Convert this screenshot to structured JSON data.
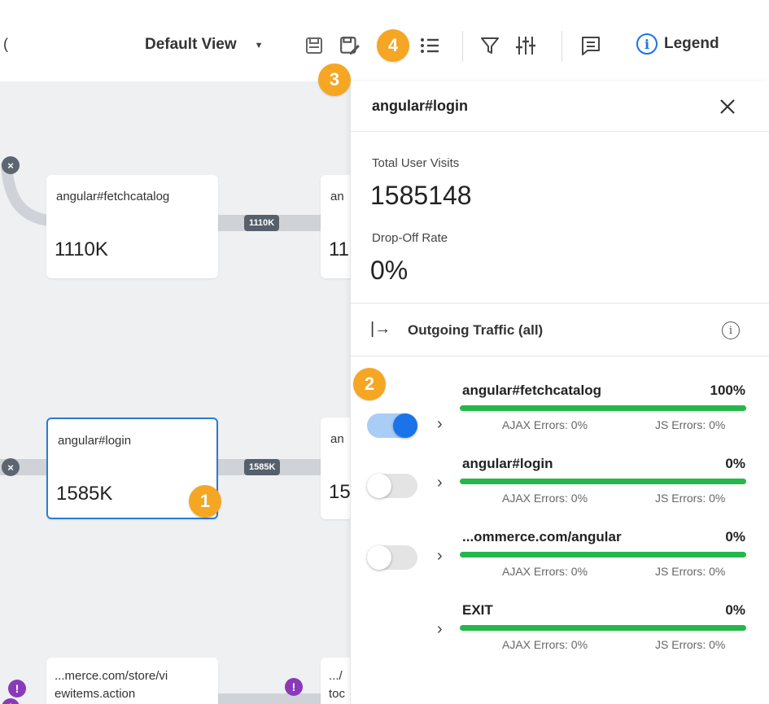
{
  "toolbar": {
    "view_label": "Default View",
    "legend_label": "Legend",
    "icons": [
      "save-icon",
      "edit-save-icon",
      "list-icon",
      "filter-icon",
      "sliders-icon",
      "comment-icon",
      "info-icon"
    ]
  },
  "badges": [
    "1",
    "2",
    "3",
    "4"
  ],
  "canvas": {
    "edges": [
      {
        "tag": "1110K"
      },
      {
        "tag": "1585K"
      }
    ],
    "nodes": [
      {
        "name": "angular#fetchcatalog",
        "count": "1110K"
      },
      {
        "name": "angular#login",
        "count": "1585K"
      },
      {
        "name_line1": "...merce.com/store/vi",
        "name_line2": "ewitems.action"
      }
    ],
    "partial_nodes": [
      {
        "name": "an",
        "count": "11"
      },
      {
        "name": "an",
        "count": "15"
      },
      {
        "name_line1": ".../",
        "name_line2": "toc"
      }
    ]
  },
  "panel": {
    "title": "angular#login",
    "total_visits_label": "Total User Visits",
    "total_visits_value": "1585148",
    "dropoff_label": "Drop-Off Rate",
    "dropoff_value": "0%",
    "outgoing_label": "Outgoing Traffic (all)",
    "traffic": [
      {
        "name": "angular#fetchcatalog",
        "pct": "100%",
        "fill": 1.0,
        "ajax": "AJAX Errors: 0%",
        "js": "JS Errors: 0%",
        "toggle": "on"
      },
      {
        "name": "angular#login",
        "pct": "0%",
        "fill": 1.0,
        "ajax": "AJAX Errors: 0%",
        "js": "JS Errors: 0%",
        "toggle": "off"
      },
      {
        "name": "...ommerce.com/angular",
        "pct": "0%",
        "fill": 1.0,
        "ajax": "AJAX Errors: 0%",
        "js": "JS Errors: 0%",
        "toggle": "off"
      },
      {
        "name": "EXIT",
        "pct": "0%",
        "fill": 1.0,
        "ajax": "AJAX Errors: 0%",
        "js": "JS Errors: 0%",
        "toggle": "none"
      }
    ]
  },
  "colors": {
    "accent": "#1a73e8",
    "badge": "#f5a623",
    "progress": "#25b74a",
    "selected_border": "#2d7ad6"
  }
}
